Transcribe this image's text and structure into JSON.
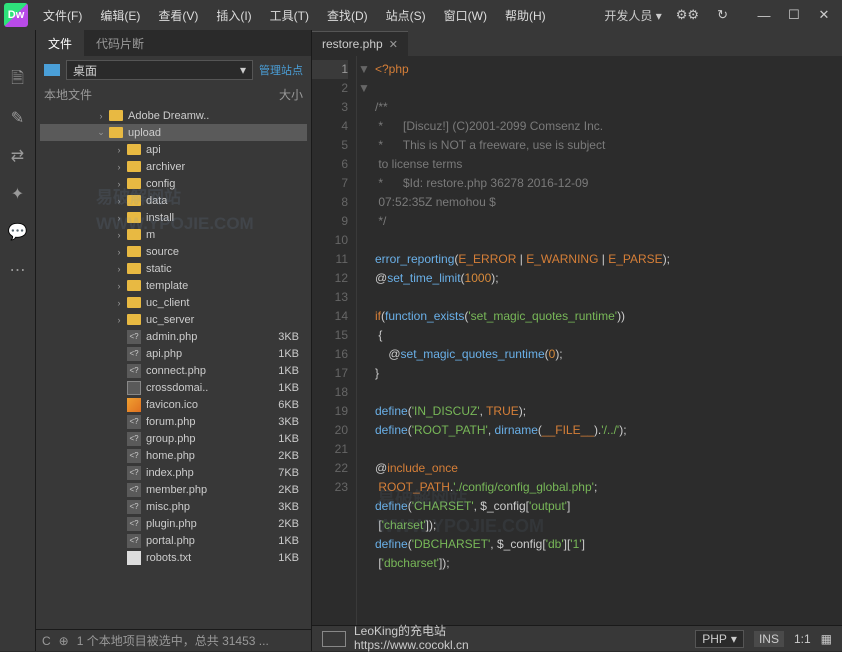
{
  "logo": "Dw",
  "menu": [
    "文件(F)",
    "编辑(E)",
    "查看(V)",
    "插入(I)",
    "工具(T)",
    "查找(D)",
    "站点(S)",
    "窗口(W)",
    "帮助(H)"
  ],
  "workspace": "开发人员",
  "panel": {
    "tabs": [
      "文件",
      "代码片断"
    ],
    "drive_label": "桌面",
    "manage_link": "管理站点",
    "col_name": "本地文件",
    "col_size": "大小",
    "tree": [
      {
        "indent": 1,
        "arrow": "›",
        "type": "folder",
        "name": "Adobe Dreamw..",
        "size": ""
      },
      {
        "indent": 1,
        "arrow": "⌄",
        "type": "folder",
        "name": "upload",
        "size": "",
        "sel": true
      },
      {
        "indent": 2,
        "arrow": "›",
        "type": "folder",
        "name": "api",
        "size": ""
      },
      {
        "indent": 2,
        "arrow": "›",
        "type": "folder",
        "name": "archiver",
        "size": ""
      },
      {
        "indent": 2,
        "arrow": "›",
        "type": "folder",
        "name": "config",
        "size": ""
      },
      {
        "indent": 2,
        "arrow": "›",
        "type": "folder",
        "name": "data",
        "size": ""
      },
      {
        "indent": 2,
        "arrow": "›",
        "type": "folder",
        "name": "install",
        "size": ""
      },
      {
        "indent": 2,
        "arrow": "›",
        "type": "folder",
        "name": "m",
        "size": ""
      },
      {
        "indent": 2,
        "arrow": "›",
        "type": "folder",
        "name": "source",
        "size": ""
      },
      {
        "indent": 2,
        "arrow": "›",
        "type": "folder",
        "name": "static",
        "size": ""
      },
      {
        "indent": 2,
        "arrow": "›",
        "type": "folder",
        "name": "template",
        "size": ""
      },
      {
        "indent": 2,
        "arrow": "›",
        "type": "folder",
        "name": "uc_client",
        "size": ""
      },
      {
        "indent": 2,
        "arrow": "›",
        "type": "folder",
        "name": "uc_server",
        "size": ""
      },
      {
        "indent": 2,
        "arrow": "",
        "type": "php",
        "name": "admin.php",
        "size": "3KB"
      },
      {
        "indent": 2,
        "arrow": "",
        "type": "php",
        "name": "api.php",
        "size": "1KB"
      },
      {
        "indent": 2,
        "arrow": "",
        "type": "php",
        "name": "connect.php",
        "size": "1KB"
      },
      {
        "indent": 2,
        "arrow": "",
        "type": "xml",
        "name": "crossdomai..",
        "size": "1KB"
      },
      {
        "indent": 2,
        "arrow": "",
        "type": "ico",
        "name": "favicon.ico",
        "size": "6KB"
      },
      {
        "indent": 2,
        "arrow": "",
        "type": "php",
        "name": "forum.php",
        "size": "3KB"
      },
      {
        "indent": 2,
        "arrow": "",
        "type": "php",
        "name": "group.php",
        "size": "1KB"
      },
      {
        "indent": 2,
        "arrow": "",
        "type": "php",
        "name": "home.php",
        "size": "2KB"
      },
      {
        "indent": 2,
        "arrow": "",
        "type": "php",
        "name": "index.php",
        "size": "7KB"
      },
      {
        "indent": 2,
        "arrow": "",
        "type": "php",
        "name": "member.php",
        "size": "2KB"
      },
      {
        "indent": 2,
        "arrow": "",
        "type": "php",
        "name": "misc.php",
        "size": "3KB"
      },
      {
        "indent": 2,
        "arrow": "",
        "type": "php",
        "name": "plugin.php",
        "size": "2KB"
      },
      {
        "indent": 2,
        "arrow": "",
        "type": "php",
        "name": "portal.php",
        "size": "1KB"
      },
      {
        "indent": 2,
        "arrow": "",
        "type": "txt",
        "name": "robots.txt",
        "size": "1KB"
      }
    ],
    "status": "1 个本地项目被选中，总共 31453 ..."
  },
  "watermark1": "易破解网站\nWWW.YPOJIE.COM",
  "watermark2": "易破解网站\nWWW.YPOJIE.COM",
  "editor": {
    "tab": "restore.php",
    "lines": [
      1,
      2,
      3,
      4,
      5,
      6,
      7,
      8,
      9,
      10,
      11,
      12,
      13,
      14,
      15,
      16,
      17,
      18,
      19,
      20,
      21,
      22,
      23
    ],
    "status_center_l1": "LeoKing的充电站",
    "status_center_l2": "https://www.cocokl.cn",
    "lang": "PHP",
    "ins": "INS",
    "pos": "1:1"
  }
}
